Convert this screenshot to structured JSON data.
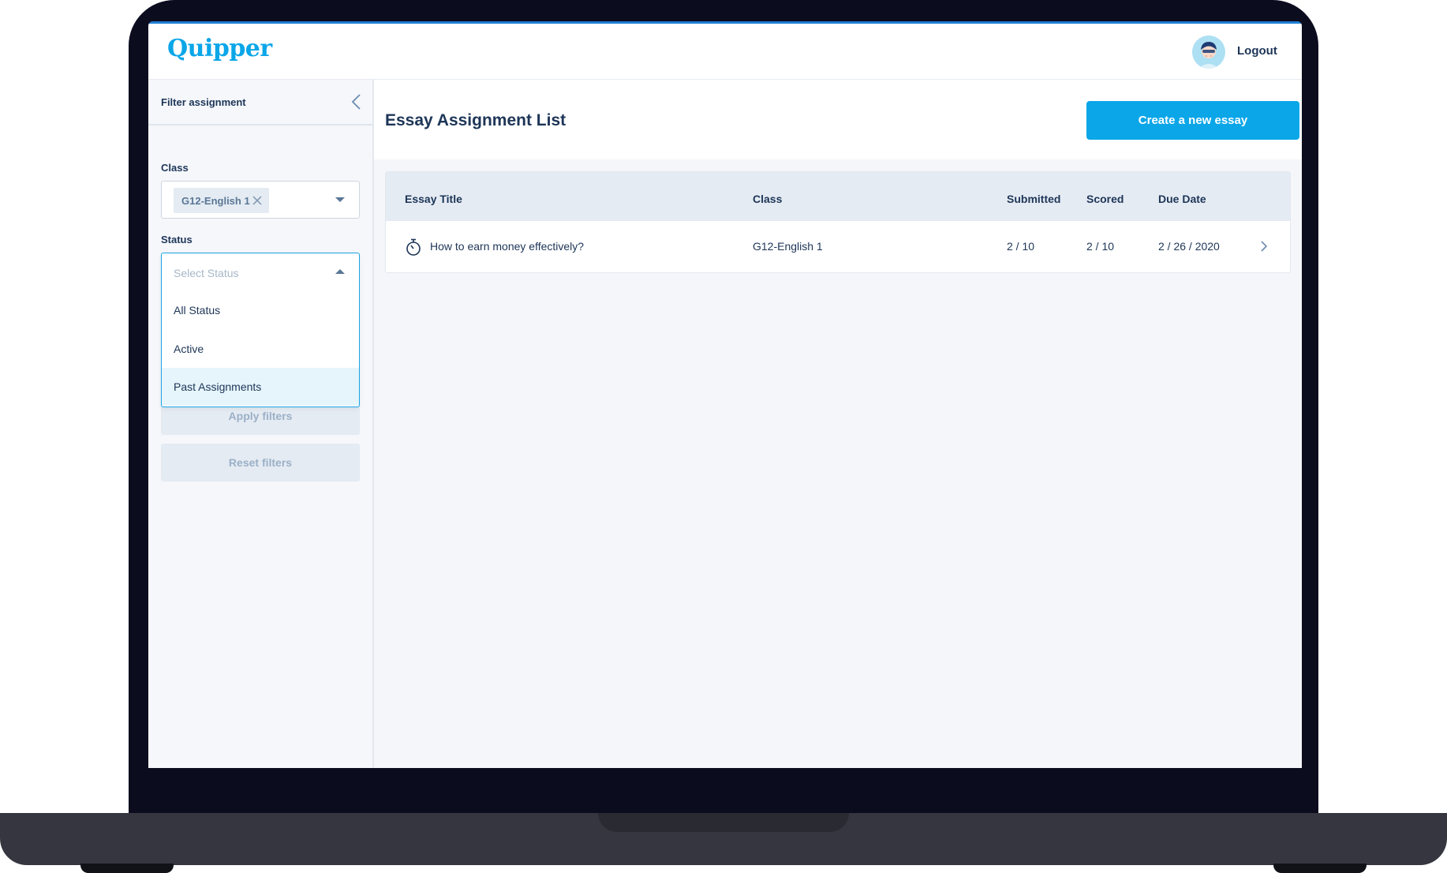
{
  "brand": {
    "logo_text": "Quipper",
    "accent": "#0aa6e8"
  },
  "header": {
    "logout_label": "Logout"
  },
  "sidebar": {
    "title": "Filter assignment",
    "class_label": "Class",
    "class_chip": "G12-English 1",
    "status_label": "Status",
    "status_placeholder": "Select Status",
    "status_options": [
      "All Status",
      "Active",
      "Past Assignments"
    ],
    "highlighted_option": "Past Assignments",
    "apply_label": "Apply filters",
    "reset_label": "Reset filters"
  },
  "main": {
    "title": "Essay Assignment List",
    "create_label": "Create a new essay",
    "columns": [
      "Essay Title",
      "Class",
      "Submitted",
      "Scored",
      "Due Date"
    ],
    "rows": [
      {
        "title": "How to earn money effectively?",
        "class": "G12-English 1",
        "submitted": "2 / 10",
        "scored": "2 / 10",
        "due_date": "2 / 26 / 2020",
        "icon": "stopwatch-icon"
      }
    ]
  }
}
